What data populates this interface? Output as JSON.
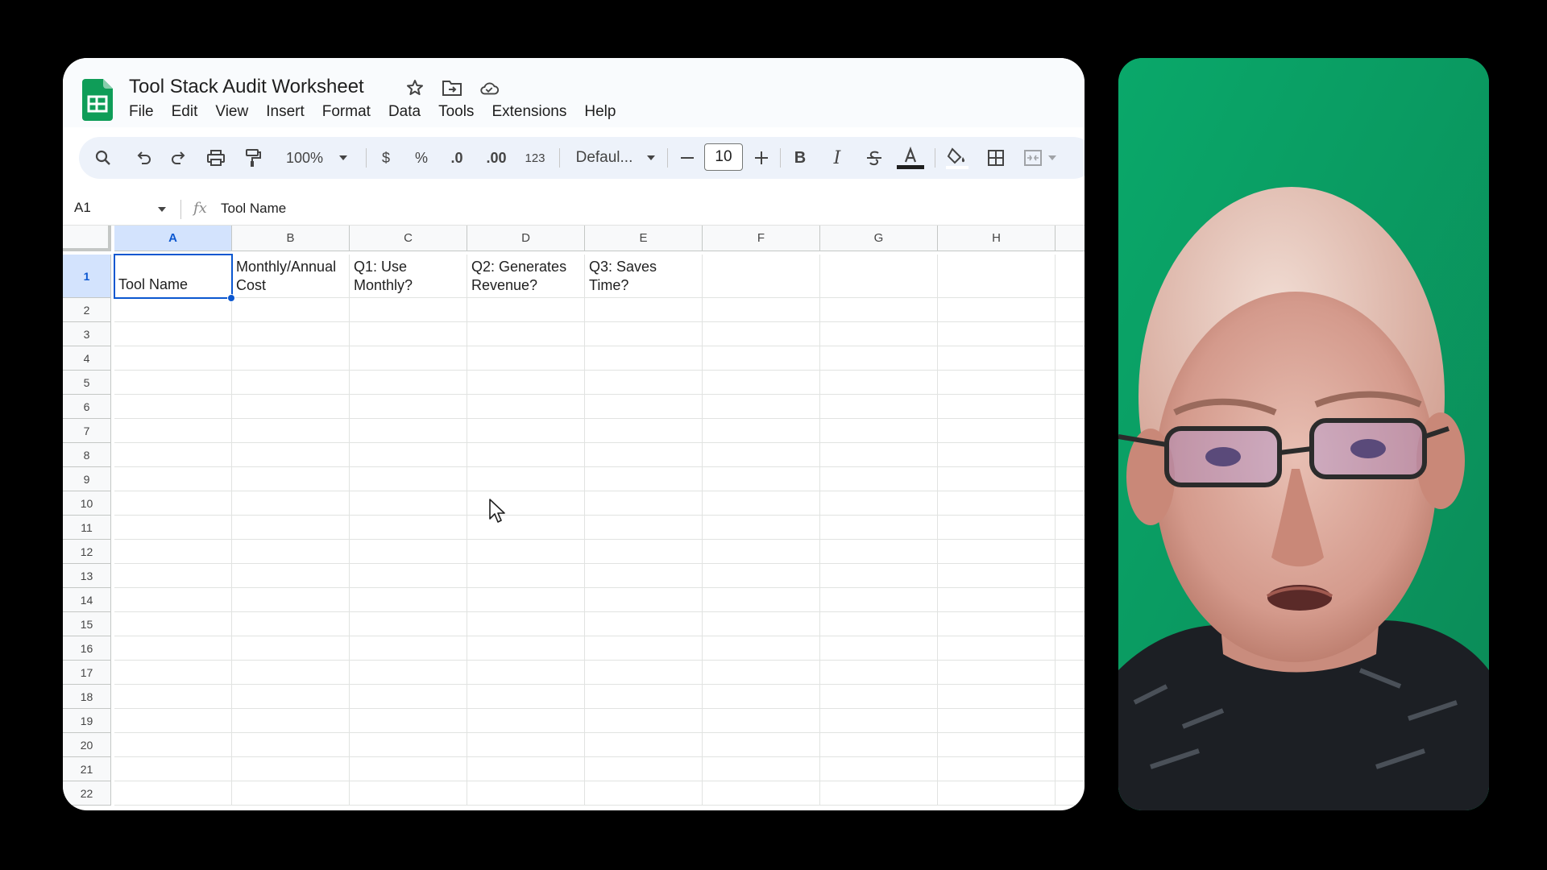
{
  "document": {
    "title": "Tool Stack Audit Worksheet"
  },
  "menu": [
    "File",
    "Edit",
    "View",
    "Insert",
    "Format",
    "Data",
    "Tools",
    "Extensions",
    "Help"
  ],
  "toolbar": {
    "zoom": "100%",
    "currency": "$",
    "percent": "%",
    "decrease_decimal": ".0",
    "increase_decimal": ".00",
    "number_format": "123",
    "font": "Defaul...",
    "font_size": "10",
    "bold": "B",
    "italic": "I"
  },
  "formula_bar": {
    "cell_ref": "A1",
    "value": "Tool Name"
  },
  "sheet": {
    "columns": [
      "A",
      "B",
      "C",
      "D",
      "E",
      "F",
      "G",
      "H"
    ],
    "selected_column": "A",
    "rows": [
      "1",
      "2",
      "3",
      "4",
      "5",
      "6",
      "7",
      "8",
      "9",
      "10",
      "11",
      "12",
      "13",
      "14",
      "15",
      "16",
      "17",
      "18",
      "19",
      "20",
      "21",
      "22"
    ],
    "selected_row": "1",
    "row1": [
      "Tool Name",
      "Monthly/Annual Cost",
      "Q1: Use Monthly?",
      "Q2: Generates Revenue?",
      "Q3: Saves Time?"
    ]
  },
  "colors": {
    "accent": "#0b57d0",
    "sheets_green": "#0f9d58",
    "webcam_bg": "#0e9a62"
  }
}
